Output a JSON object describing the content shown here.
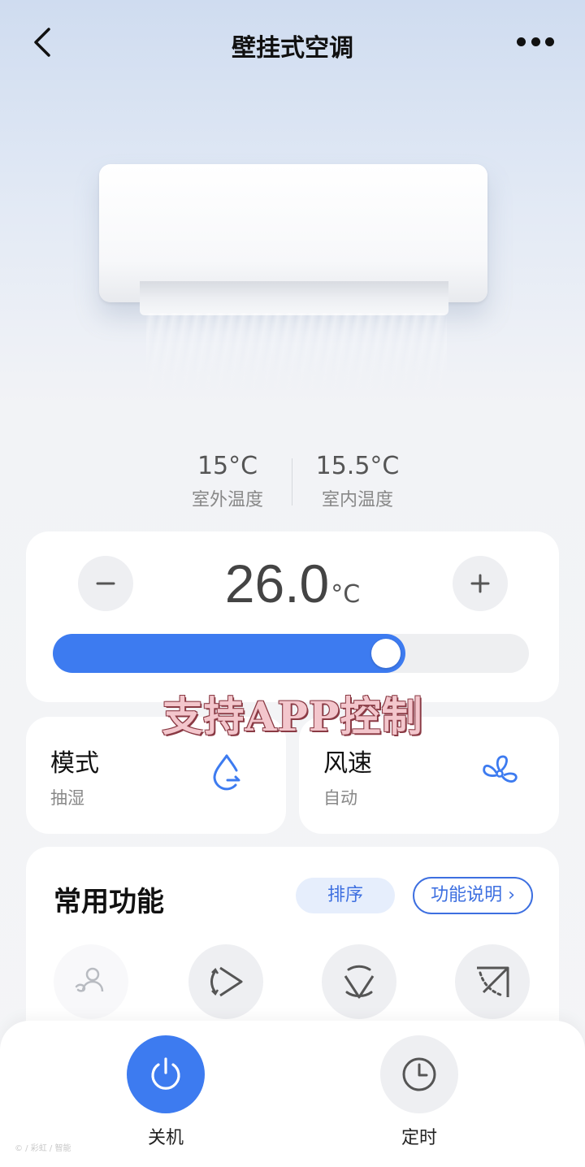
{
  "nav": {
    "title": "壁挂式空调",
    "back_icon": "chevron-left-icon",
    "more_icon": "more-dots-icon"
  },
  "environment": {
    "outdoor_temp": "15°C",
    "outdoor_label": "室外温度",
    "indoor_temp": "15.5°C",
    "indoor_label": "室内温度"
  },
  "thermostat": {
    "set_temp": "26.0",
    "unit": "°C",
    "slider_fraction": 0.74,
    "minus_icon": "minus-icon",
    "plus_icon": "plus-icon"
  },
  "promo_text": "支持APP控制",
  "mode": {
    "title": "模式",
    "value": "抽湿",
    "icon": "dehumidify-drop-icon"
  },
  "wind": {
    "title": "风速",
    "value": "自动",
    "icon": "fan-icon"
  },
  "functions": {
    "title": "常用功能",
    "sort_label": "排序",
    "help_label": "功能说明 ›",
    "icons": [
      "person-airflow-icon",
      "swing-horizontal-icon",
      "swing-vertical-icon",
      "angle-airflow-icon"
    ]
  },
  "bottom": {
    "power_label": "关机",
    "timer_label": "定时"
  },
  "watermark": "© / 彩虹 / 智能",
  "colors": {
    "accent": "#3d7bf0",
    "slider_track": "#eeeff1"
  }
}
